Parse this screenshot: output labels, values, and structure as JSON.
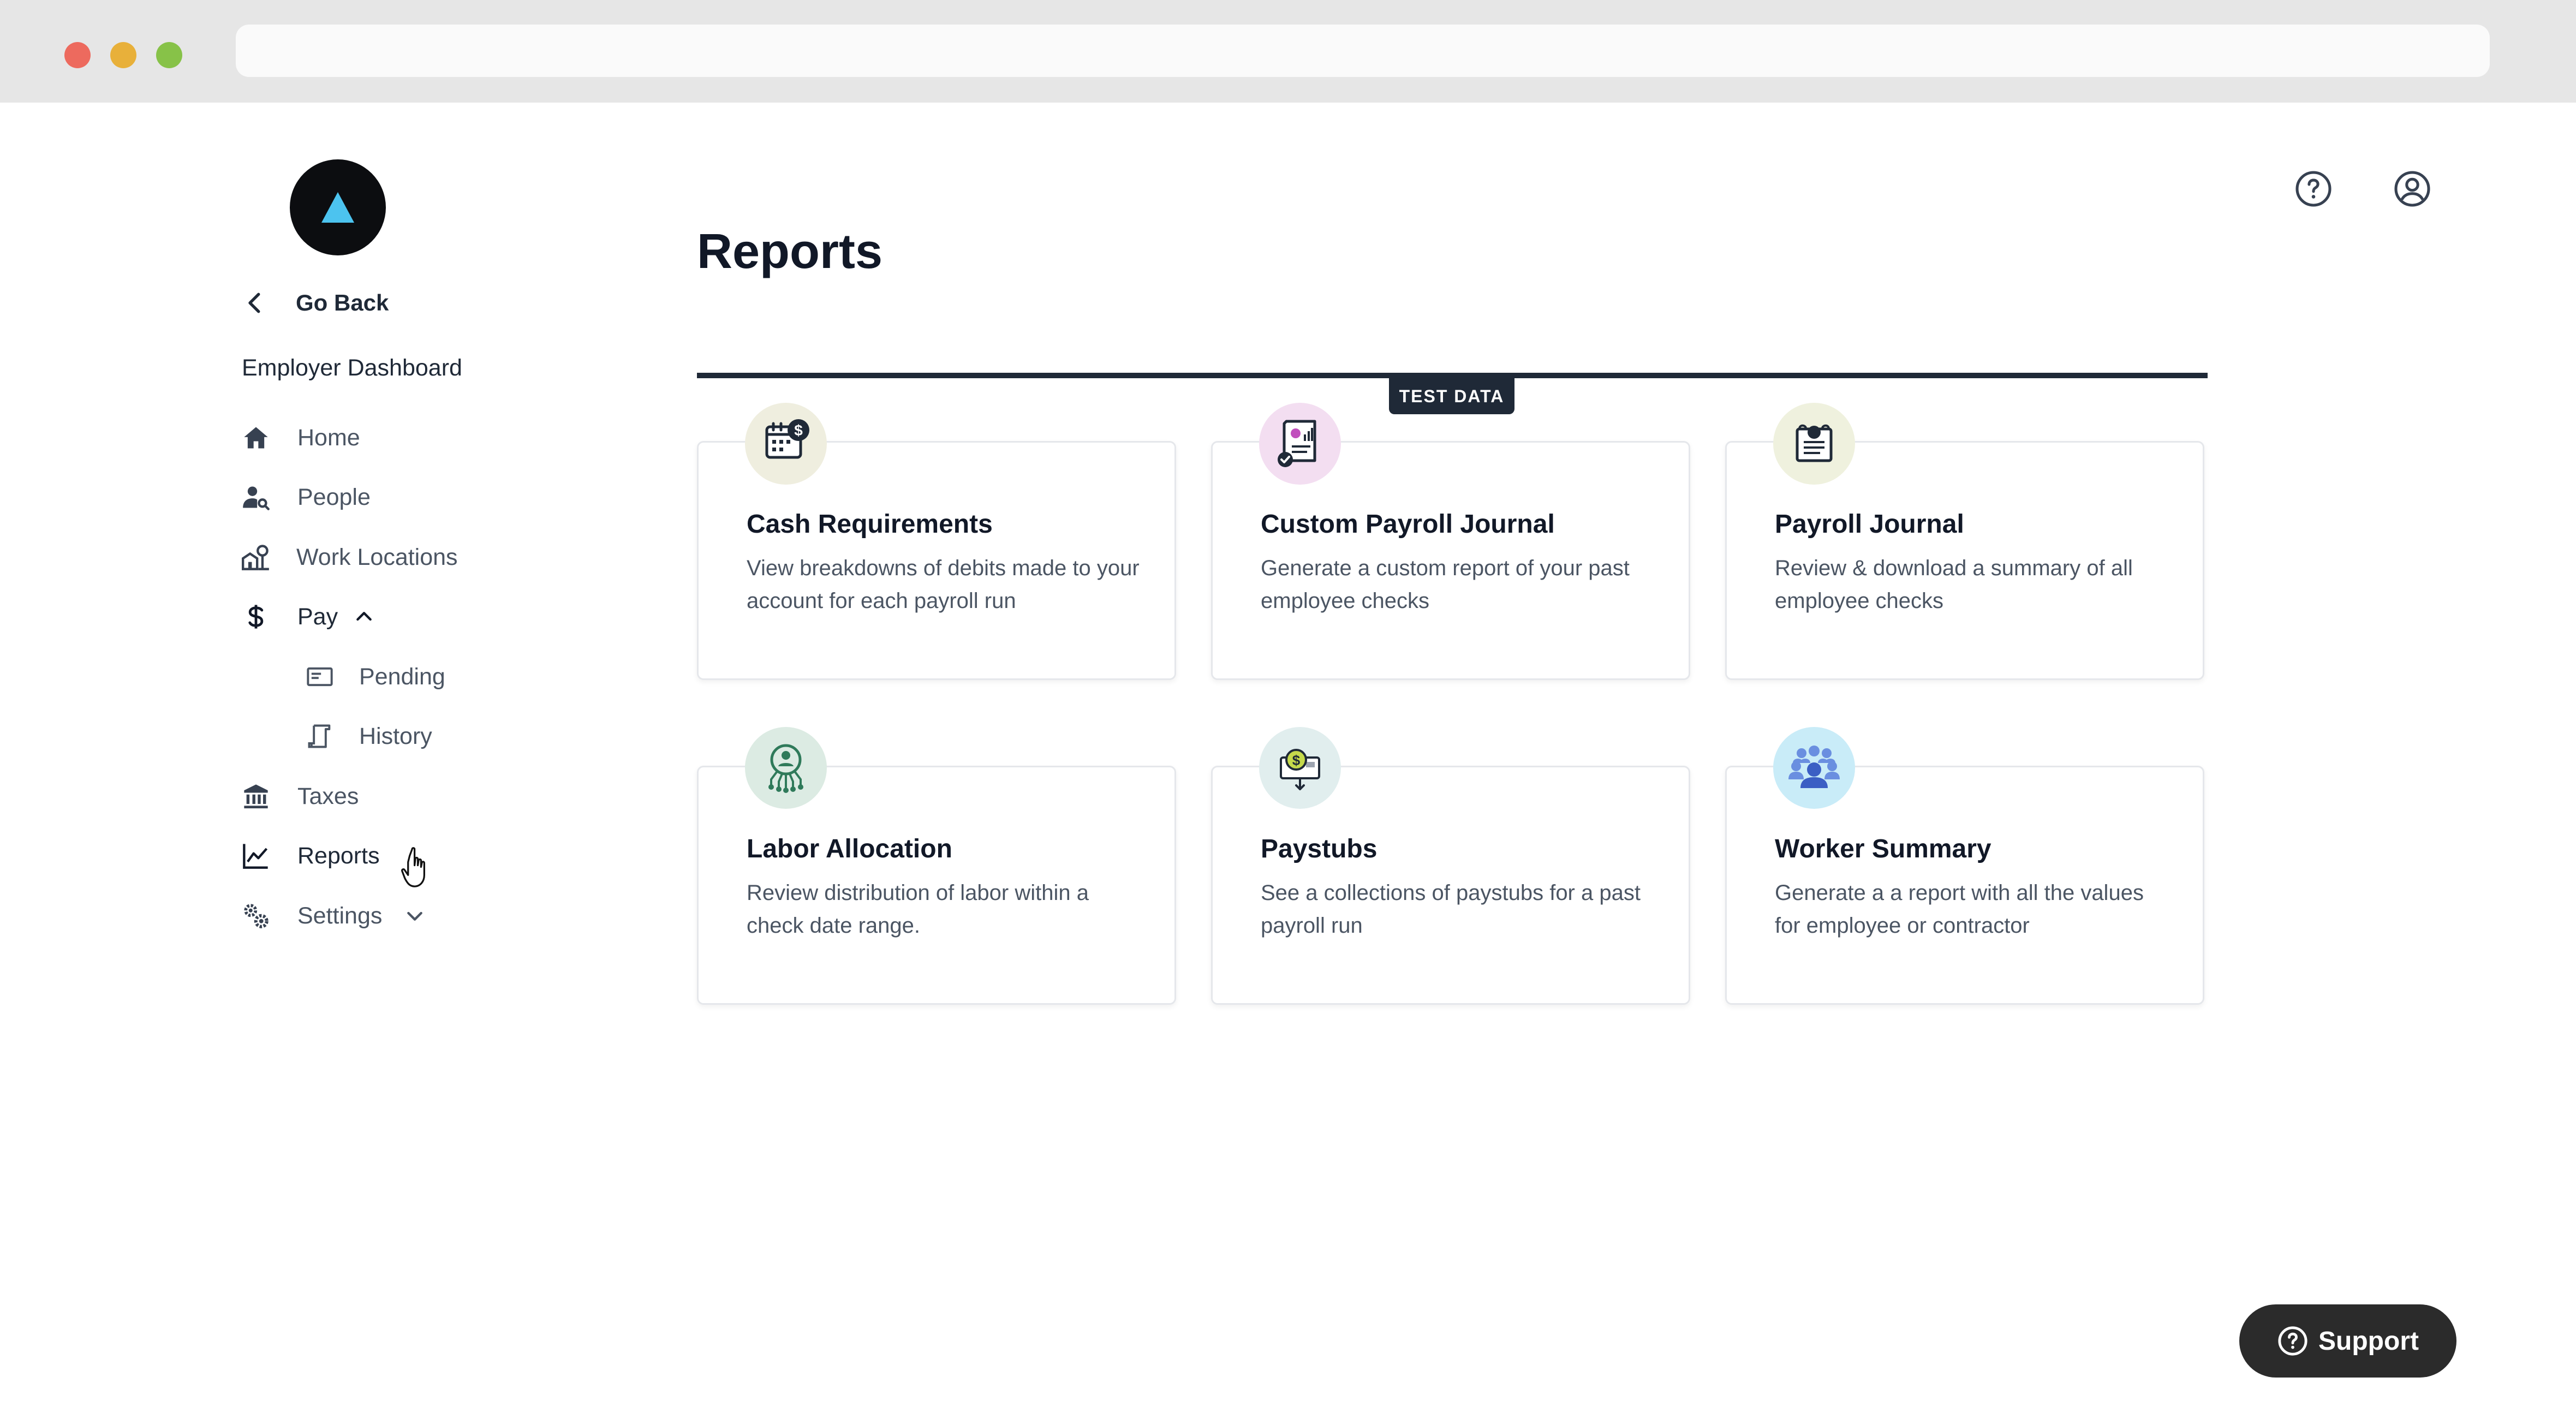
{
  "sidebar": {
    "go_back": "Go Back",
    "section_title": "Employer Dashboard",
    "items": [
      {
        "label": "Home",
        "icon": "home-icon"
      },
      {
        "label": "People",
        "icon": "people-icon"
      },
      {
        "label": "Work Locations",
        "icon": "work-locations-icon"
      },
      {
        "label": "Pay",
        "icon": "dollar-icon"
      },
      {
        "label": "Pending",
        "icon": "pending-icon"
      },
      {
        "label": "History",
        "icon": "history-icon"
      },
      {
        "label": "Taxes",
        "icon": "bank-icon"
      },
      {
        "label": "Reports",
        "icon": "chart-line-icon"
      },
      {
        "label": "Settings",
        "icon": "settings-gears-icon"
      }
    ]
  },
  "main": {
    "title": "Reports",
    "badge": "TEST DATA",
    "cards": [
      {
        "title": "Cash Requirements",
        "description": "View breakdowns of debits made to your account for each payroll run",
        "icon": "calendar-dollar-icon",
        "icon_bg": "#efeedf"
      },
      {
        "title": "Custom Payroll Journal",
        "description": "Generate a custom report of your past employee checks",
        "icon": "report-check-icon",
        "icon_bg": "#f3def1"
      },
      {
        "title": "Payroll Journal",
        "description": "Review & download a summary of all employee checks",
        "icon": "journal-icon",
        "icon_bg": "#eff1de"
      },
      {
        "title": "Labor Allocation",
        "description": "Review distribution of labor within a check date range.",
        "icon": "network-person-icon",
        "icon_bg": "#dcebe3"
      },
      {
        "title": "Paystubs",
        "description": "See a collections of paystubs for a past payroll run",
        "icon": "paystub-icon",
        "icon_bg": "#e1eeee"
      },
      {
        "title": "Worker Summary",
        "description": "Generate a a report with all the values for employee or contractor",
        "icon": "group-icon",
        "icon_bg": "#c9ecf8"
      }
    ]
  },
  "support": {
    "label": "Support"
  },
  "colors": {
    "accent": "#1f2937",
    "logo_triangle": "#4cc3ef"
  }
}
